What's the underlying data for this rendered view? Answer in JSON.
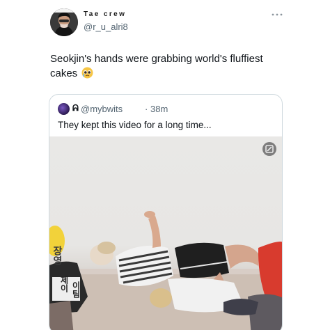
{
  "author": {
    "display_name": "Tae crew",
    "handle": "@r_u_alri8"
  },
  "tweet": {
    "text": "Seokjin's hands were grabbing world's fluffiest cakes",
    "emoji": "pleading-face-with-tears"
  },
  "quote": {
    "mark": "ᕱ",
    "handle": "@mybwits",
    "separator": "·",
    "time": "38m",
    "text": "They kept this video for a long time..."
  },
  "media": {
    "type": "video",
    "overlay_text_1": "장영",
    "overlay_text_2": "제이",
    "overlay_text_3": "이팀"
  },
  "icons": {
    "more": "more-horizontal-icon",
    "gif": "gif-toggle-icon"
  },
  "colors": {
    "secondary_text": "#536471",
    "border": "#cfd9de",
    "primary_text": "#0f1419"
  }
}
